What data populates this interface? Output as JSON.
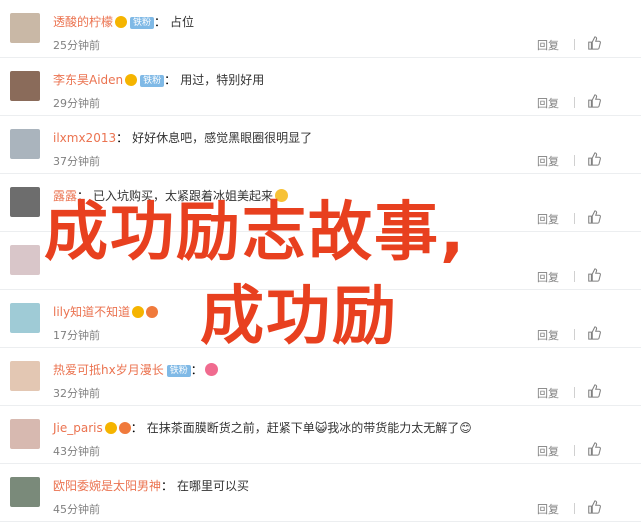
{
  "ui": {
    "reply_label": "回复",
    "like_icon": "thumbs-up-icon"
  },
  "comments": [
    {
      "username": "透酸的柠檬",
      "badges": [
        "vip"
      ],
      "fan_badge": "铁粉",
      "text": "占位",
      "time": "25分钟前",
      "avatar_color": "#c9b8a6"
    },
    {
      "username": "李东昊Aiden",
      "badges": [
        "vip"
      ],
      "fan_badge": "铁粉",
      "text": "用过，特别好用",
      "time": "29分钟前",
      "avatar_color": "#8a6b5a"
    },
    {
      "username": "ilxmx2013",
      "badges": [],
      "fan_badge": "",
      "text": "好好休息吧，感觉黑眼圈很明显了",
      "time": "37分钟前",
      "avatar_color": "#aab4bd"
    },
    {
      "username": "露露",
      "badges": [],
      "fan_badge": "",
      "text": "已入坑购买，太紧跟着冰姐美起来",
      "time": "",
      "avatar_color": "#6d6d6d"
    },
    {
      "username": "",
      "badges": [],
      "fan_badge": "",
      "text": "",
      "time": "",
      "avatar_color": "#d9c6c9"
    },
    {
      "username": "lily知道不知道",
      "badges": [
        "vip",
        "crown"
      ],
      "fan_badge": "",
      "text": "",
      "time": "17分钟前",
      "avatar_color": "#9fcbd6"
    },
    {
      "username": "热爱可抵hx岁月漫长",
      "badges": [],
      "fan_badge": "铁粉",
      "text": "",
      "time": "32分钟前",
      "avatar_color": "#e3c7b3"
    },
    {
      "username": "Jie_paris",
      "badges": [
        "vip",
        "crown"
      ],
      "fan_badge": "",
      "text": "在抹茶面膜断货之前，赶紧下单😺我冰的带货能力太无解了😊",
      "time": "43分钟前",
      "avatar_color": "#d7b9b0"
    },
    {
      "username": "欧阳委婉是太阳男神",
      "badges": [],
      "fan_badge": "",
      "text": "在哪里可以买",
      "time": "45分钟前",
      "avatar_color": "#7a8a7a"
    }
  ],
  "overlay": {
    "line1": "成功励志故事,",
    "line2": "成功励"
  },
  "colors": {
    "username": "#eb7350",
    "overlay": "#e8401f",
    "meta": "#808080"
  }
}
